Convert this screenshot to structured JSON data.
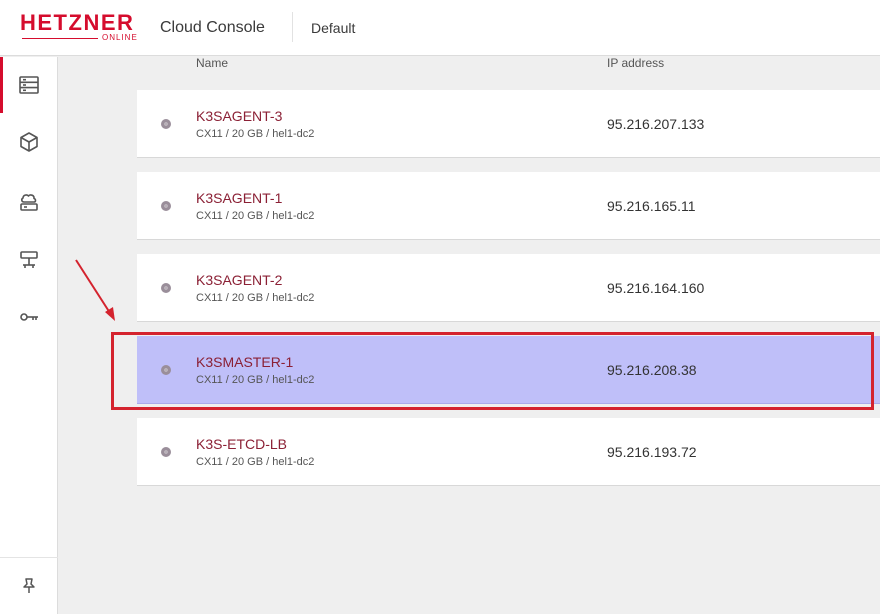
{
  "header": {
    "logo_text": "HETZNER",
    "logo_sub": "ONLINE",
    "app_title": "Cloud Console",
    "project": "Default"
  },
  "sidebar": {
    "items": [
      {
        "icon": "servers-icon",
        "active": true
      },
      {
        "icon": "box-icon",
        "active": false
      },
      {
        "icon": "cloud-storage-icon",
        "active": false
      },
      {
        "icon": "network-icon",
        "active": false
      },
      {
        "icon": "key-icon",
        "active": false
      }
    ],
    "bottom_icon": "pin-icon"
  },
  "table": {
    "columns": [
      "Name",
      "IP address"
    ],
    "rows": [
      {
        "name": "K3SAGENT-3",
        "specs": "CX11 / 20 GB / hel1-dc2",
        "ip": "95.216.207.133",
        "selected": false
      },
      {
        "name": "K3SAGENT-1",
        "specs": "CX11 / 20 GB / hel1-dc2",
        "ip": "95.216.165.11",
        "selected": false
      },
      {
        "name": "K3SAGENT-2",
        "specs": "CX11 / 20 GB / hel1-dc2",
        "ip": "95.216.164.160",
        "selected": false
      },
      {
        "name": "K3SMASTER-1",
        "specs": "CX11 / 20 GB / hel1-dc2",
        "ip": "95.216.208.38",
        "selected": true
      },
      {
        "name": "K3S-ETCD-LB",
        "specs": "CX11 / 20 GB / hel1-dc2",
        "ip": "95.216.193.72",
        "selected": false
      }
    ]
  },
  "colors": {
    "brand": "#d50c2d",
    "selected_row": "#bfbff9",
    "annotation": "#d4232e"
  }
}
